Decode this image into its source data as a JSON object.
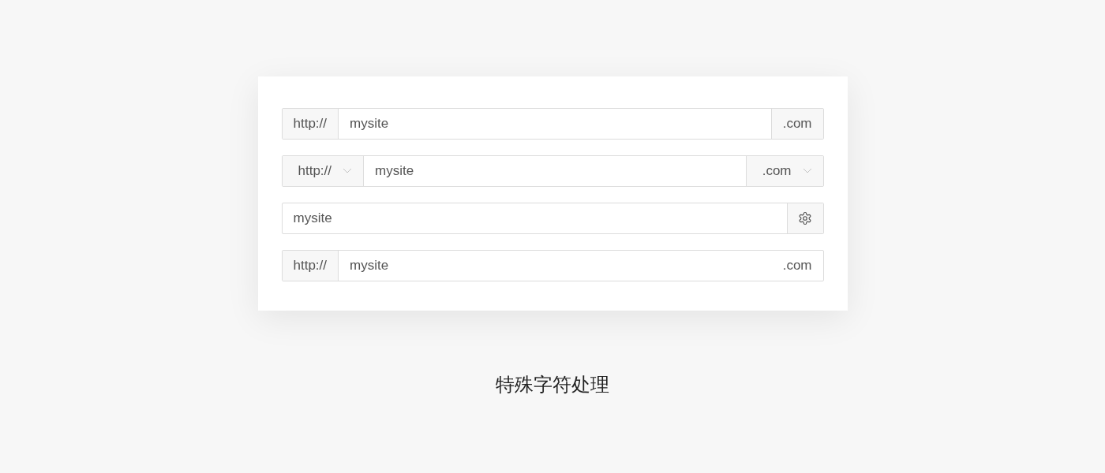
{
  "inputs": [
    {
      "prefix": {
        "kind": "addon",
        "text": "http://"
      },
      "value": "mysite",
      "suffix": {
        "kind": "addon",
        "text": ".com"
      }
    },
    {
      "prefix": {
        "kind": "select",
        "text": "http://"
      },
      "value": "mysite",
      "suffix": {
        "kind": "select",
        "text": ".com"
      }
    },
    {
      "value": "mysite",
      "suffix": {
        "kind": "icon"
      }
    },
    {
      "prefix": {
        "kind": "addon",
        "text": "http://"
      },
      "value": "mysite",
      "suffix": {
        "kind": "inline",
        "text": ".com"
      }
    }
  ],
  "caption": "特殊字符处理"
}
